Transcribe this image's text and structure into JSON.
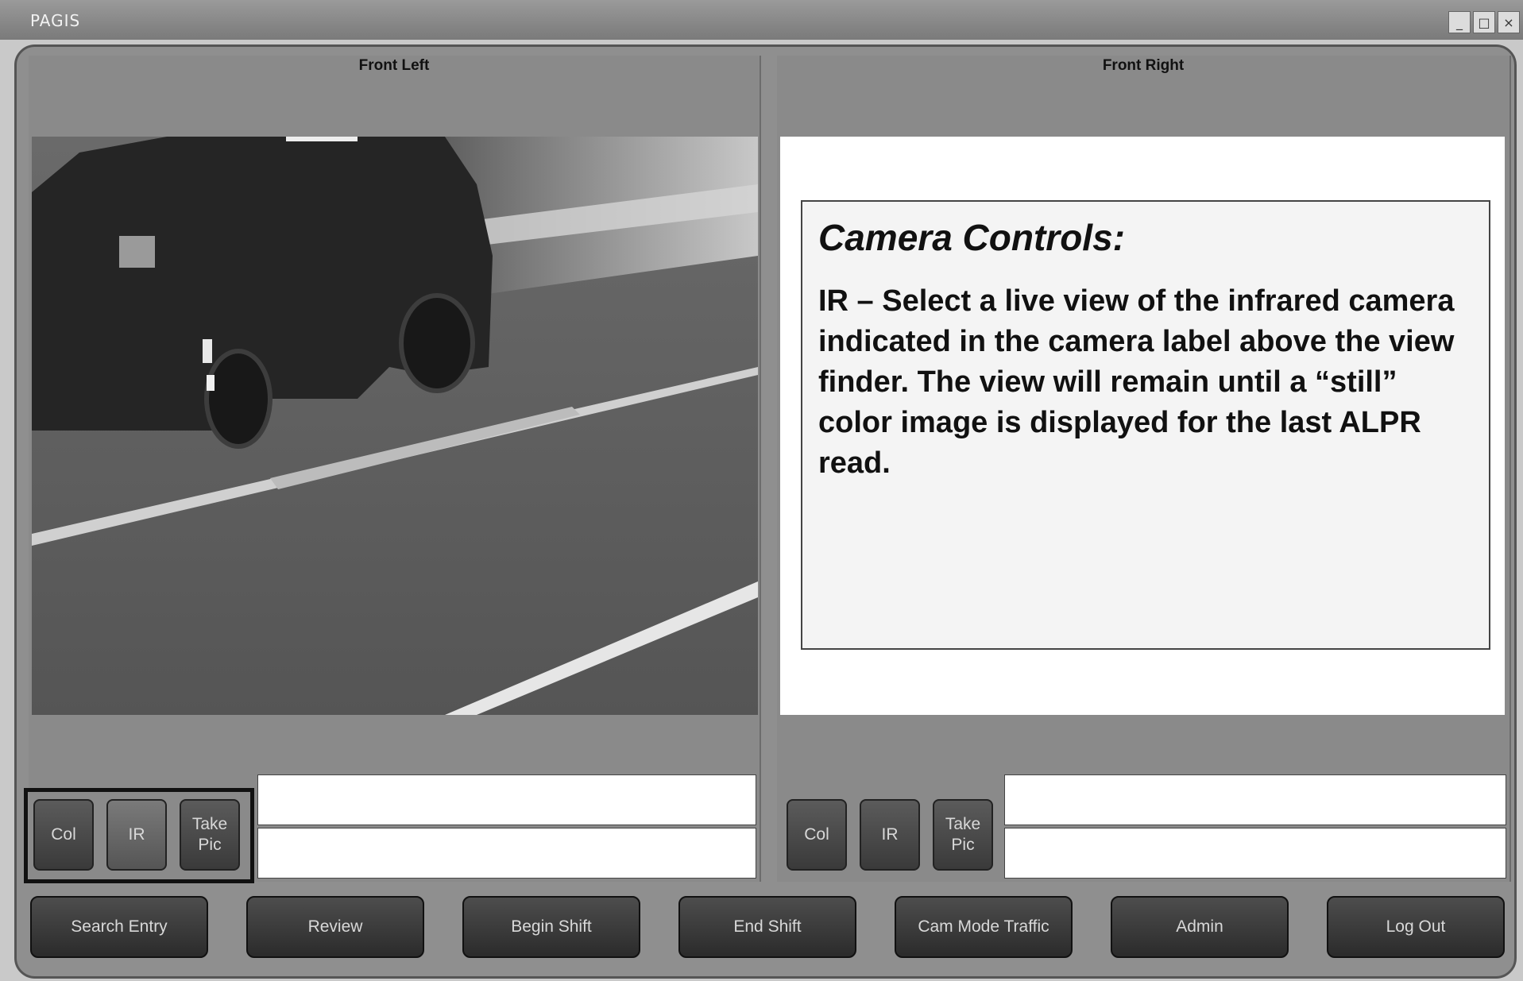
{
  "window": {
    "title": "PAGIS",
    "controls": {
      "minimize": "_",
      "maximize": "□",
      "close": "×"
    }
  },
  "cameras": {
    "left": {
      "label": "Front Left",
      "buttons": {
        "col": "Col",
        "ir": "IR",
        "take_pic": "Take Pic"
      },
      "active_button": "IR"
    },
    "right": {
      "label": "Front Right",
      "buttons": {
        "col": "Col",
        "ir": "IR",
        "take_pic": "Take Pic"
      }
    }
  },
  "callout": {
    "title": "Camera Controls:",
    "text": "IR – Select a live view of the infrared camera indicated in the camera label above the view finder. The view will remain until a “still” color image is displayed for the last ALPR read."
  },
  "bottom_nav": {
    "search_entry": "Search Entry",
    "review": "Review",
    "begin_shift": "Begin Shift",
    "end_shift": "End Shift",
    "cam_mode": "Cam Mode Traffic",
    "admin": "Admin",
    "log_out": "Log Out"
  }
}
